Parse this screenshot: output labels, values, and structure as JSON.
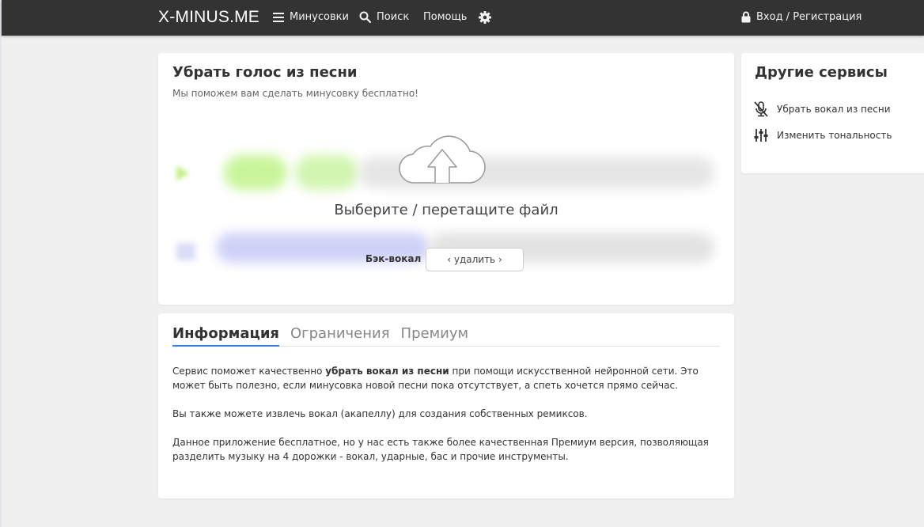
{
  "navbar": {
    "brand": "X-MINUS.ME",
    "menu_label": "Минусовки",
    "search_label": "Поиск",
    "help_label": "Помощь",
    "login_label": "Вход / Регистрация"
  },
  "main": {
    "title": "Убрать голос из песни",
    "subtitle": "Мы поможем вам сделать минусовку бесплатно!",
    "upload_text": "Выберите / перетащите файл",
    "backvocal_label": "Бэк-вокал",
    "remove_button": "‹ удалить ›"
  },
  "side": {
    "title": "Другие сервисы",
    "items": [
      {
        "label": "Убрать вокал из песни",
        "icon": "mic-off-icon"
      },
      {
        "label": "Изменить тональность",
        "icon": "sliders-icon"
      }
    ]
  },
  "info": {
    "tabs": [
      {
        "label": "Информация",
        "active": true
      },
      {
        "label": "Ограничения",
        "active": false
      },
      {
        "label": "Премиум",
        "active": false
      }
    ],
    "p1_before": "Сервис поможет качественно ",
    "p1_bold": "убрать вокал из песни",
    "p1_after": " при помощи искусственной нейронной сети. Это может быть полезно, если минусовка новой песни пока отсутствует, а спеть хочется прямо сейчас.",
    "p2": "Вы также можете извлечь вокал (акапеллу) для создания собственных ремиксов.",
    "p3": "Данное приложение бесплатное, но у нас есть также более качественная Премиум версия, позволяющая разделить музыку на 4 дорожки - вокал, ударные, бас и прочие инструменты."
  },
  "colors": {
    "navbar": "#333333",
    "accent": "#3b7ddd",
    "background": "#f0f0f0"
  }
}
